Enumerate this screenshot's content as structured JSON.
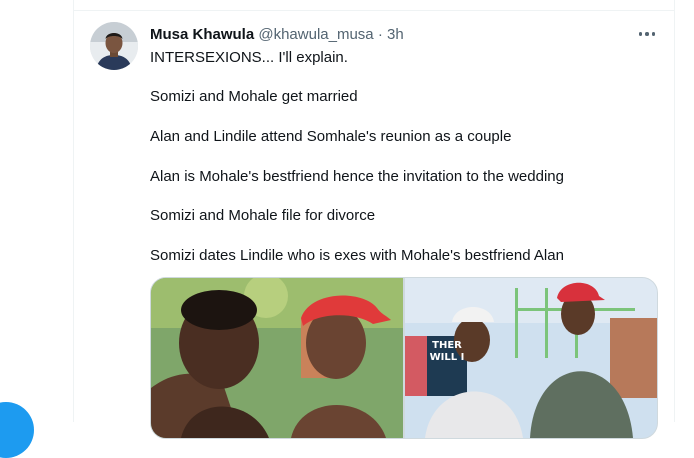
{
  "tweet": {
    "display_name": "Musa Khawula",
    "handle": "@khawula_musa",
    "separator": "·",
    "time": "3h",
    "lines": [
      "INTERSEXIONS... I'll explain.",
      "Somizi and Mohale get married",
      "Alan and Lindile attend Somhale's reunion as a couple",
      "Alan is Mohale's bestfriend hence the invitation to the wedding",
      "Somizi and Mohale file for divorce",
      "Somizi dates Lindile who is exes with Mohale's bestfriend Alan"
    ]
  },
  "media": {
    "sign_line_1": "THER",
    "sign_line_2": "WILL I"
  },
  "colors": {
    "accent": "#1d9bf0",
    "text_primary": "#0f1419",
    "text_secondary": "#536471",
    "border": "#eff3f4"
  },
  "icons": {
    "more": "more-horizontal-icon",
    "compose": "compose-fab"
  }
}
